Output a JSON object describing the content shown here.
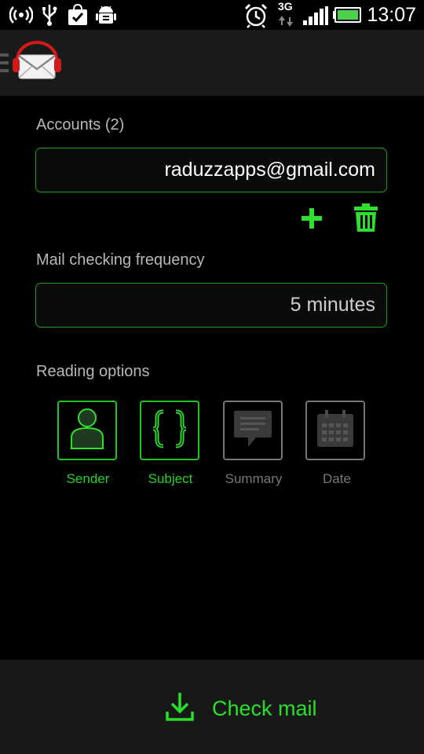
{
  "status_bar": {
    "time": "13:07",
    "network": "3G",
    "icons": [
      "hotspot-icon",
      "usb-icon",
      "shopping-bag-icon",
      "android-debug-icon",
      "alarm-icon",
      "signal-icon",
      "battery-icon"
    ]
  },
  "action_bar": {
    "logo": "mail-headphones-logo",
    "menu": "drawer-icon"
  },
  "accounts": {
    "label": "Accounts (2)",
    "value": "raduzzapps@gmail.com",
    "add_icon": "plus-icon",
    "delete_icon": "trash-icon"
  },
  "frequency": {
    "label": "Mail checking frequency",
    "value": "5 minutes"
  },
  "reading": {
    "label": "Reading options",
    "options": [
      {
        "label": "Sender",
        "icon": "person-icon",
        "enabled": true
      },
      {
        "label": "Subject",
        "icon": "braces-icon",
        "enabled": true
      },
      {
        "label": "Summary",
        "icon": "speech-bubble-icon",
        "enabled": false
      },
      {
        "label": "Date",
        "icon": "calendar-icon",
        "enabled": false
      }
    ]
  },
  "check_mail": {
    "label": "Check mail",
    "icon": "download-icon"
  },
  "colors": {
    "accent": "#25d325",
    "border": "#1d9e1d",
    "disabled": "#777777",
    "background": "#000000"
  }
}
